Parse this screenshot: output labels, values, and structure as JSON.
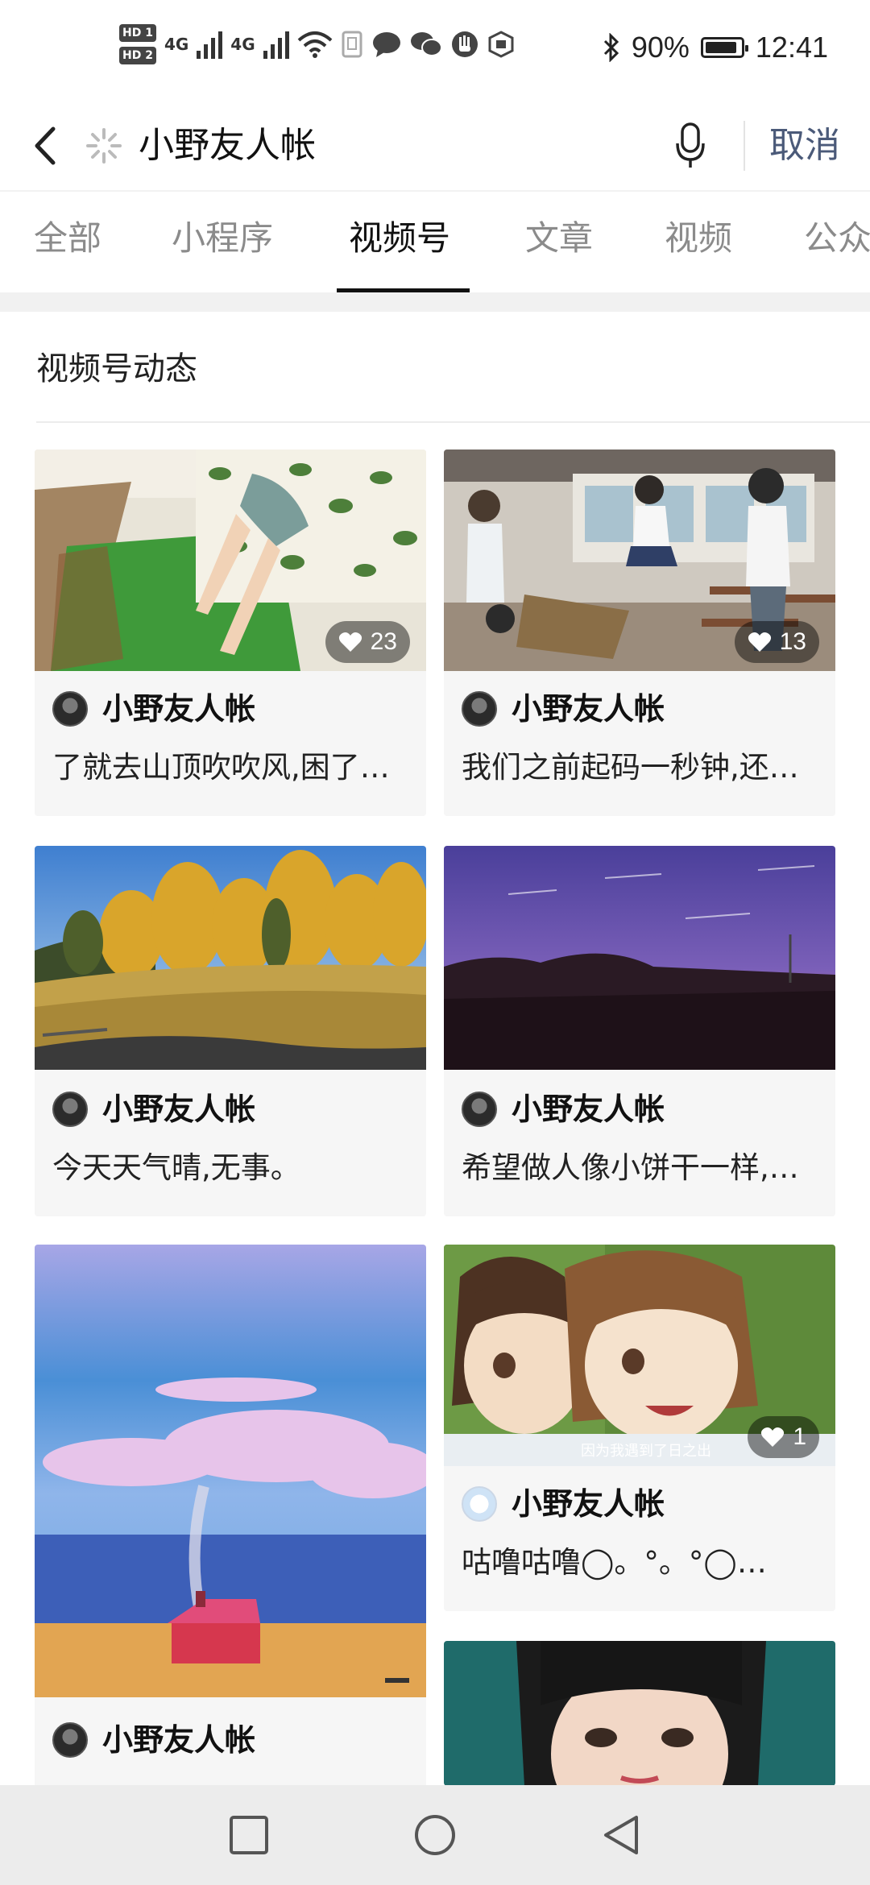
{
  "status_bar": {
    "sim1": "HD 1",
    "sim2": "HD 2",
    "net1": "4G",
    "net2": "4G",
    "battery_text": "90%",
    "time": "12:41"
  },
  "search": {
    "query": "小野友人帐",
    "cancel_label": "取消"
  },
  "tabs": [
    {
      "label": "全部",
      "active": false
    },
    {
      "label": "小程序",
      "active": false
    },
    {
      "label": "视频号",
      "active": true
    },
    {
      "label": "文章",
      "active": false
    },
    {
      "label": "视频",
      "active": false
    },
    {
      "label": "公众",
      "active": false
    }
  ],
  "section_title": "视频号动态",
  "posts": [
    {
      "author": "小野友人帐",
      "desc": "了就去山顶吹吹风,困了…",
      "likes": "23",
      "thumb": "anime-girl-lying-grass"
    },
    {
      "author": "小野友人帐",
      "desc": "我们之前起码一秒钟,还…",
      "likes": "13",
      "thumb": "anime-classroom"
    },
    {
      "author": "小野友人帐",
      "desc": "今天天气晴,无事。",
      "likes": "",
      "thumb": "autumn-trees-road"
    },
    {
      "author": "小野友人帐",
      "desc": "希望做人像小饼干一样,…",
      "likes": "",
      "thumb": "purple-sunset-field"
    },
    {
      "author": "小野友人帐",
      "desc": "",
      "likes": "",
      "thumb": "pink-clouds-red-house"
    },
    {
      "author": "小野友人帐",
      "desc": "咕噜咕噜◯。°。°◯…",
      "likes": "1",
      "thumb": "anime-two-girls",
      "caption": "因为我遇到了日之出"
    },
    {
      "author": "",
      "desc": "",
      "likes": "",
      "thumb": "girl-portrait-teal"
    }
  ],
  "colors": {
    "cancel": "#4b5a79",
    "active_tab": "#111111",
    "inactive_tab": "#8b8b8b",
    "card_bg": "#f6f6f6"
  },
  "icons": [
    "back-arrow-icon",
    "loading-spinner-icon",
    "microphone-icon",
    "heart-icon",
    "square-nav-icon",
    "circle-nav-icon",
    "triangle-back-nav-icon"
  ]
}
